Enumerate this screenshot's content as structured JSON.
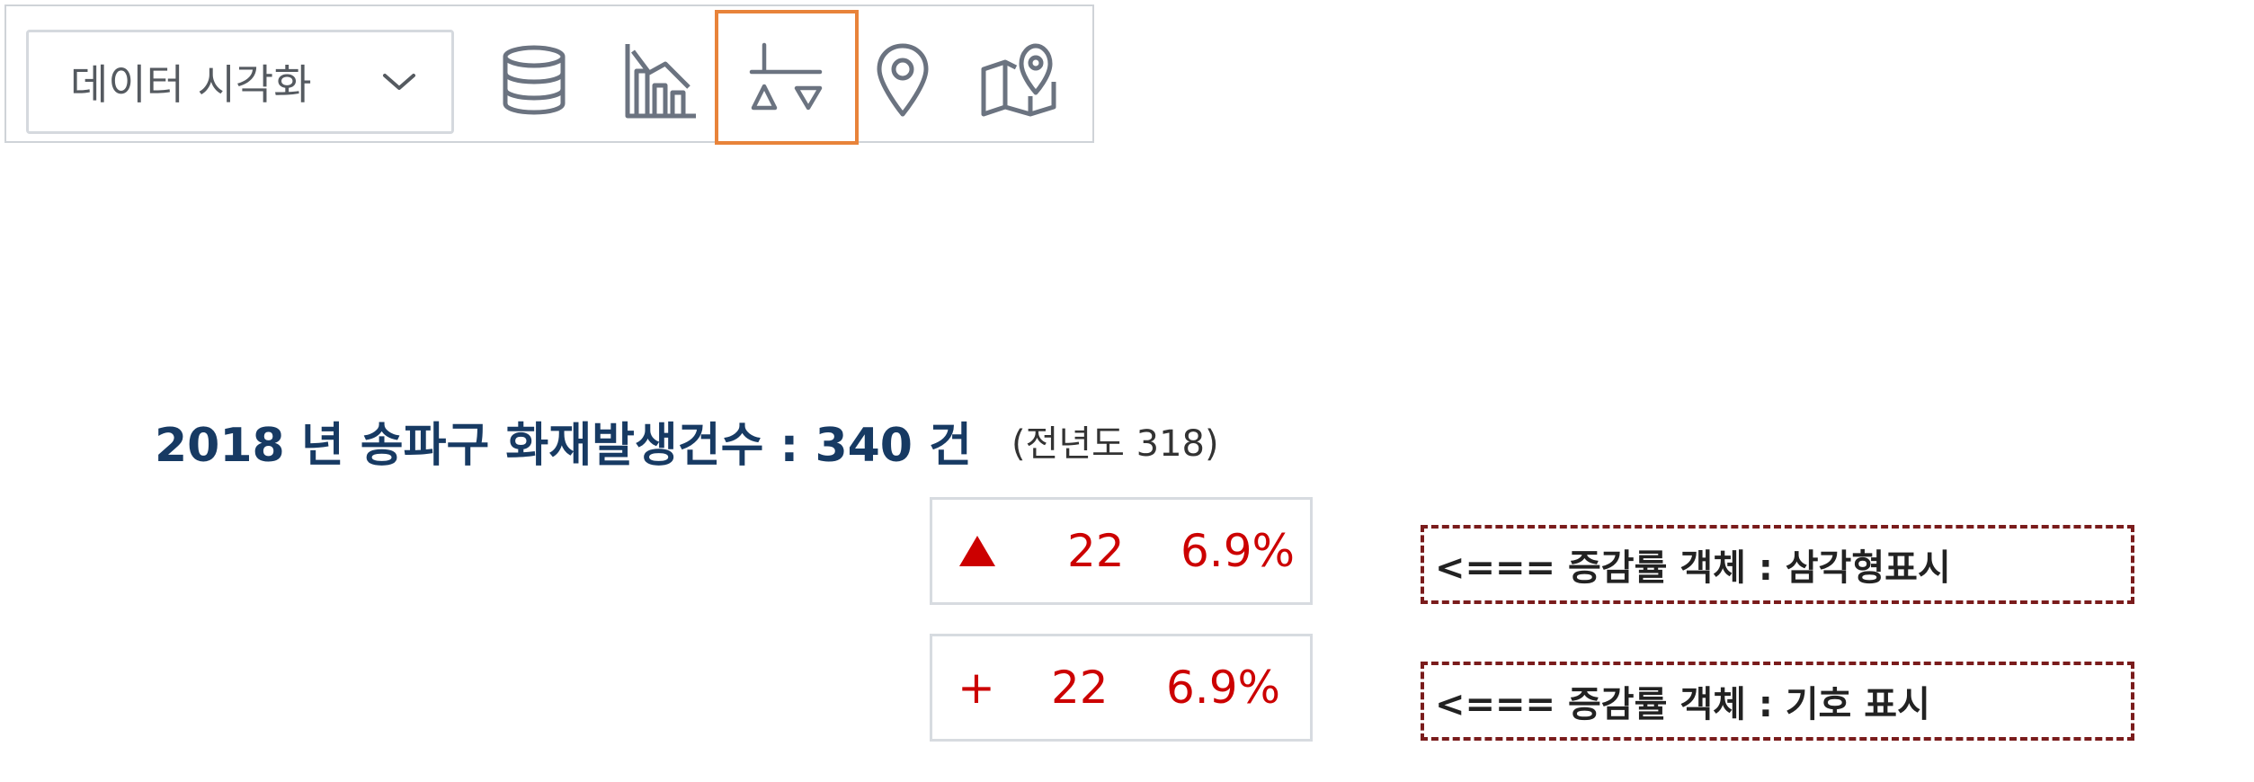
{
  "toolbar": {
    "dropdown": {
      "label": "데이터 시각화",
      "icon": "chevron-down-icon"
    },
    "tools": [
      {
        "icon": "database-icon",
        "active": false
      },
      {
        "icon": "bar-line-chart-icon",
        "active": false
      },
      {
        "icon": "plus-triangle-symbol-icon",
        "active": true
      },
      {
        "icon": "map-pin-icon",
        "active": false
      },
      {
        "icon": "map-icon",
        "active": false
      }
    ],
    "active_color": "#e8833a",
    "icon_color": "#6b7380"
  },
  "heading": {
    "main": "2018 년 송파구 화재발생건수 : 340 건",
    "sub": "(전년도 318)",
    "color": "#173a63"
  },
  "rate_boxes": [
    {
      "symbol": "▲",
      "symbol_icon": "up-triangle-icon",
      "value": "22",
      "percent": "6.9%"
    },
    {
      "symbol": "+",
      "symbol_icon": "plus-icon",
      "value": "22",
      "percent": "6.9%"
    }
  ],
  "rate_color": "#cc0000",
  "notes": [
    {
      "text": "<=== 증감률 객체 :  삼각형표시"
    },
    {
      "text": "<=== 증감률 객체 :  기호 표시"
    }
  ],
  "note_border_color": "#7a1c1c"
}
